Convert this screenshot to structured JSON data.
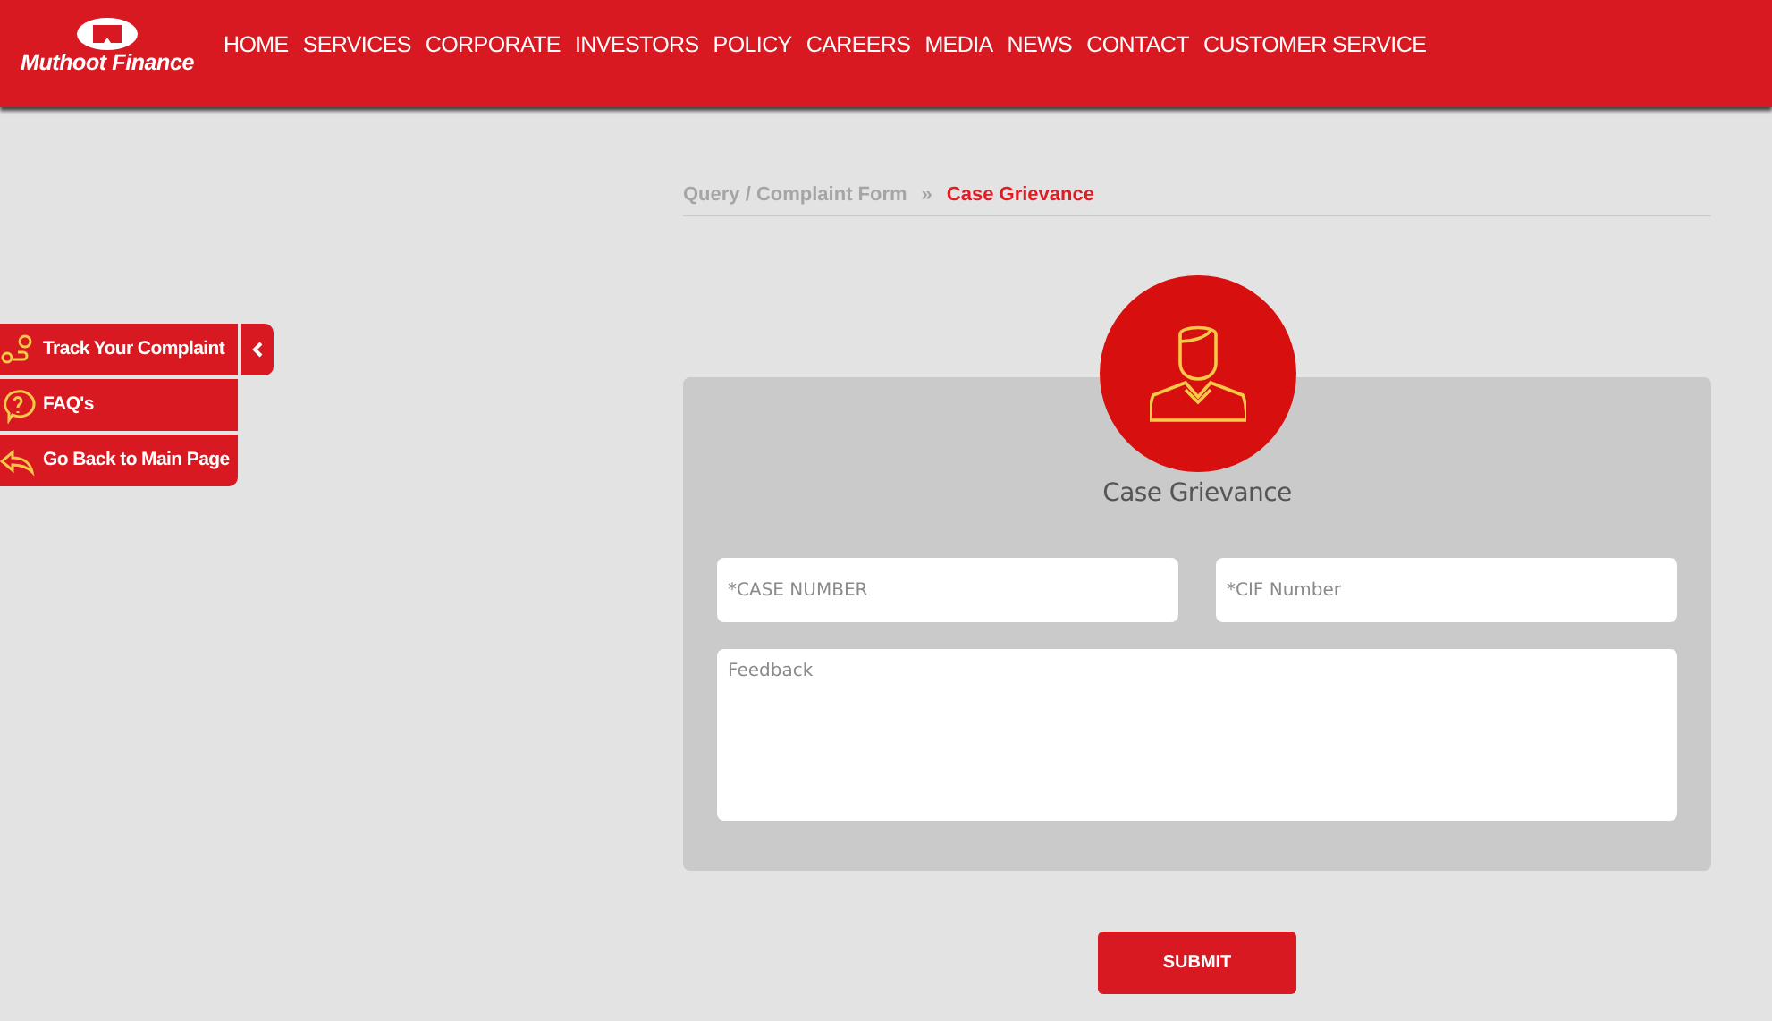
{
  "header": {
    "logo_text": "Muthoot Finance",
    "nav": [
      {
        "label": "HOME"
      },
      {
        "label": "SERVICES"
      },
      {
        "label": "CORPORATE"
      },
      {
        "label": "INVESTORS"
      },
      {
        "label": "POLICY"
      },
      {
        "label": "CAREERS"
      },
      {
        "label": "MEDIA"
      },
      {
        "label": "NEWS"
      },
      {
        "label": "CONTACT"
      },
      {
        "label": "CUSTOMER SERVICE"
      }
    ]
  },
  "side_menu": {
    "items": [
      {
        "kind": "track",
        "label": "Track Your Complaint"
      },
      {
        "kind": "faq",
        "label": "FAQ's"
      },
      {
        "kind": "back",
        "label": "Go Back to Main Page"
      }
    ]
  },
  "breadcrumb_separator": "»",
  "breadcrumb": [
    {
      "label": "Query / Complaint Form",
      "selected": false
    },
    {
      "label": "Case Grievance",
      "selected": true
    }
  ],
  "form": {
    "title": "Case Grievance",
    "fields": [
      {
        "kind": "input",
        "placeholder": "*CASE NUMBER"
      },
      {
        "kind": "input",
        "placeholder": "*CIF Number"
      },
      {
        "kind": "textarea",
        "placeholder": "Feedback"
      }
    ],
    "submit": "SUBMIT"
  }
}
